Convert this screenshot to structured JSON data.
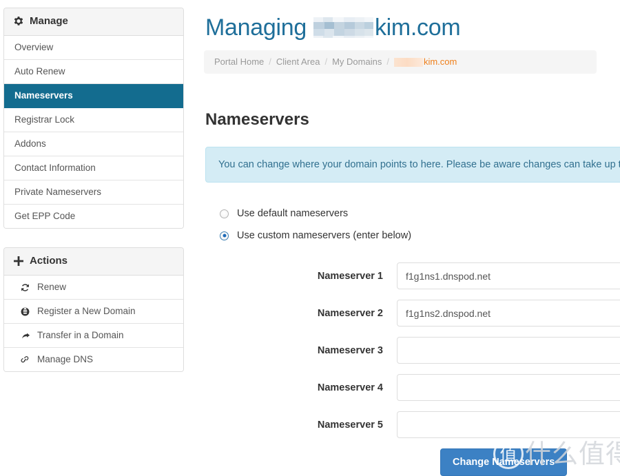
{
  "header": {
    "title_prefix": "Managing",
    "title_domain_suffix": "kim.com",
    "title_redacted": true
  },
  "breadcrumb": {
    "items": [
      {
        "label": "Portal Home",
        "current": false
      },
      {
        "label": "Client Area",
        "current": false
      },
      {
        "label": "My Domains",
        "current": false
      }
    ],
    "separator": "/",
    "last_item_suffix": "kim.com",
    "last_item_redacted": true
  },
  "sidebar": {
    "manage_panel": {
      "heading": "Manage",
      "heading_icon": "gear-icon",
      "items": [
        {
          "label": "Overview",
          "active": false
        },
        {
          "label": "Auto Renew",
          "active": false
        },
        {
          "label": "Nameservers",
          "active": true
        },
        {
          "label": "Registrar Lock",
          "active": false
        },
        {
          "label": "Addons",
          "active": false
        },
        {
          "label": "Contact Information",
          "active": false
        },
        {
          "label": "Private Nameservers",
          "active": false
        },
        {
          "label": "Get EPP Code",
          "active": false
        }
      ]
    },
    "actions_panel": {
      "heading": "Actions",
      "heading_icon": "plus-icon",
      "items": [
        {
          "label": "Renew",
          "icon": "refresh-icon"
        },
        {
          "label": "Register a New Domain",
          "icon": "globe-icon"
        },
        {
          "label": "Transfer in a Domain",
          "icon": "arrow-forward-icon"
        },
        {
          "label": "Manage DNS",
          "icon": "link-icon"
        }
      ]
    }
  },
  "main": {
    "section_title": "Nameservers",
    "alert": {
      "text": "You can change where your domain points to here. Please be aware changes can take up to",
      "type": "info"
    },
    "nameserver_mode": {
      "options": [
        {
          "label": "Use default nameservers",
          "selected": false
        },
        {
          "label": "Use custom nameservers (enter below)",
          "selected": true
        }
      ]
    },
    "fields": [
      {
        "label": "Nameserver 1",
        "value": "f1g1ns1.dnspod.net",
        "placeholder": ""
      },
      {
        "label": "Nameserver 2",
        "value": "f1g1ns2.dnspod.net",
        "placeholder": ""
      },
      {
        "label": "Nameserver 3",
        "value": "",
        "placeholder": ""
      },
      {
        "label": "Nameserver 4",
        "value": "",
        "placeholder": ""
      },
      {
        "label": "Nameserver 5",
        "value": "",
        "placeholder": ""
      }
    ],
    "submit_button": "Change Nameservers"
  },
  "watermark": {
    "logo_glyph": "值",
    "text": "什么值得买"
  },
  "colors": {
    "sidebar_active": "#136c8f",
    "title_blue": "#1f6f9a",
    "breadcrumb_active": "#ef7f1a",
    "alert_bg": "#d4ecf5",
    "alert_text": "#31708f",
    "button_primary": "#3c81c4"
  }
}
